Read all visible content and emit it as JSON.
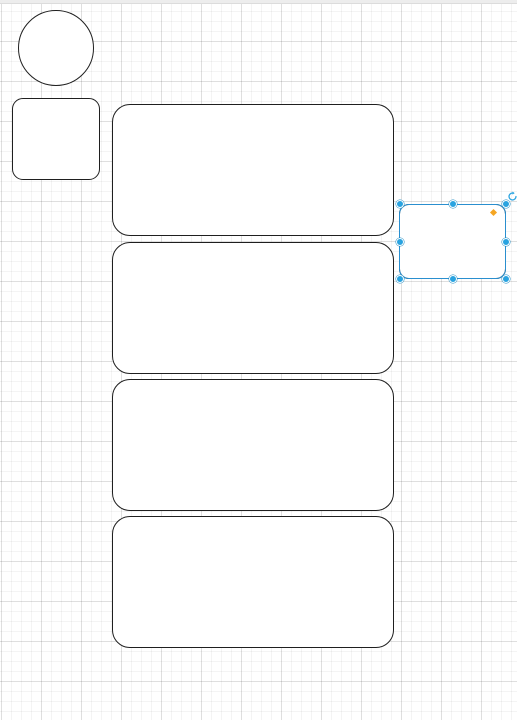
{
  "canvas": {
    "grid": true,
    "background_color": "#ffffff",
    "grid_color": "#e8e8e8"
  },
  "shapes": [
    {
      "id": "circle",
      "type": "ellipse"
    },
    {
      "id": "small-rounded-rect",
      "type": "rounded-rectangle"
    },
    {
      "id": "large-rounded-rect-1",
      "type": "rounded-rectangle"
    },
    {
      "id": "large-rounded-rect-2",
      "type": "rounded-rectangle"
    },
    {
      "id": "large-rounded-rect-3",
      "type": "rounded-rectangle"
    },
    {
      "id": "large-rounded-rect-4",
      "type": "rounded-rectangle"
    },
    {
      "id": "selected-rounded-rect",
      "type": "rounded-rectangle",
      "selected": true
    }
  ],
  "selection": {
    "handle_color": "#29a3e0",
    "adjust_handle_color": "#f5a623",
    "rotate_icon": "rotate-icon"
  }
}
